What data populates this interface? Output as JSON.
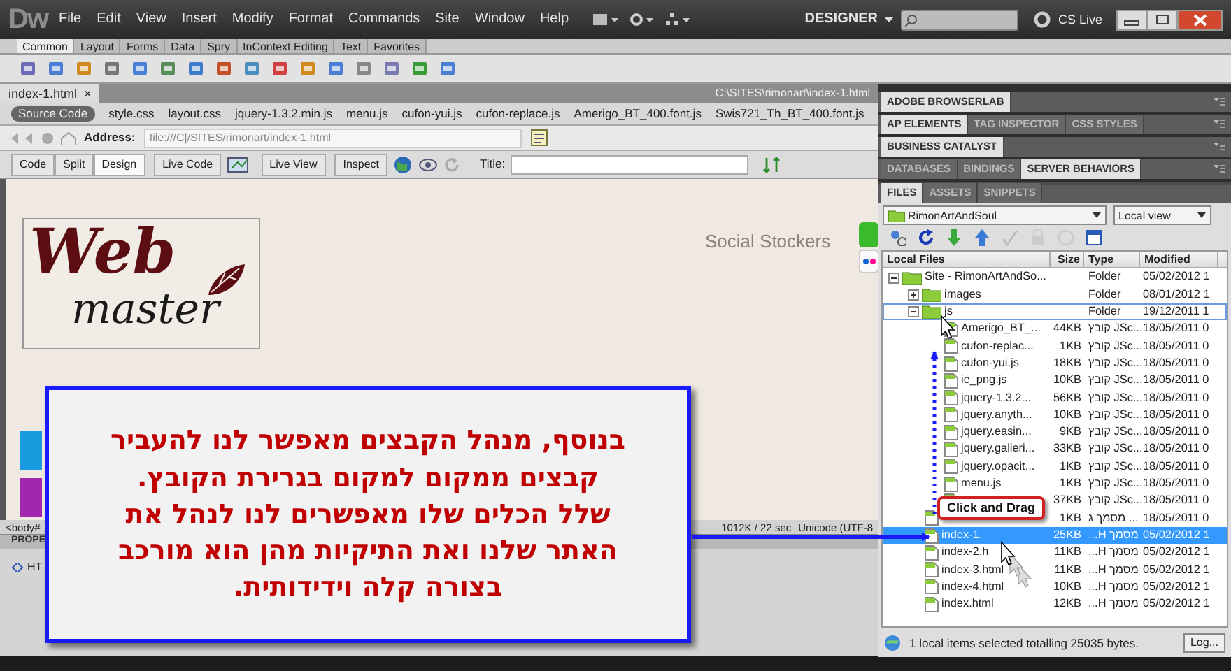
{
  "app": {
    "logo": "Dw",
    "menus": [
      "File",
      "Edit",
      "View",
      "Insert",
      "Modify",
      "Format",
      "Commands",
      "Site",
      "Window",
      "Help"
    ],
    "workspace": "DESIGNER",
    "cs_live": "CS Live"
  },
  "insert_bar": {
    "tabs": [
      {
        "label": "Common",
        "selected": true
      },
      {
        "label": "Layout",
        "selected": false
      },
      {
        "label": "Forms",
        "selected": false
      },
      {
        "label": "Data",
        "selected": false
      },
      {
        "label": "Spry",
        "selected": false
      },
      {
        "label": "InContext Editing",
        "selected": false
      },
      {
        "label": "Text",
        "selected": false
      },
      {
        "label": "Favorites",
        "selected": false
      }
    ]
  },
  "document": {
    "tab": "index-1.html",
    "close": "×",
    "path": "C:\\SITES\\rimonart\\index-1.html",
    "related_files": [
      {
        "label": "Source Code",
        "selected": true
      },
      {
        "label": "style.css",
        "selected": false
      },
      {
        "label": "layout.css",
        "selected": false
      },
      {
        "label": "jquery-1.3.2.min.js",
        "selected": false
      },
      {
        "label": "menu.js",
        "selected": false
      },
      {
        "label": "cufon-yui.js",
        "selected": false
      },
      {
        "label": "cufon-replace.js",
        "selected": false
      },
      {
        "label": "Amerigo_BT_400.font.js",
        "selected": false
      },
      {
        "label": "Swis721_Th_BT_400.font.js",
        "selected": false
      }
    ],
    "address_label": "Address:",
    "address": "file:///C|/SITES/rimonart/index-1.html",
    "view_buttons": [
      {
        "label": "Code",
        "selected": false
      },
      {
        "label": "Split",
        "selected": false
      },
      {
        "label": "Design",
        "selected": true
      }
    ],
    "tool_buttons": [
      "Live Code",
      "Live View",
      "Inspect"
    ],
    "title_label": "Title:"
  },
  "design_view": {
    "logo_top": "Web",
    "logo_bottom": "master",
    "social_label": "Social Stockers"
  },
  "status_bar": {
    "tag": "<body#",
    "size": "1012K / 22 sec",
    "encoding": "Unicode (UTF-8"
  },
  "properties": {
    "header": "PROPE",
    "html_button": "HT"
  },
  "panels": [
    {
      "tabs": [
        {
          "label": "ADOBE BROWSERLAB",
          "selected": true
        }
      ]
    },
    {
      "tabs": [
        {
          "label": "AP ELEMENTS",
          "selected": true
        },
        {
          "label": "TAG INSPECTOR",
          "selected": false
        },
        {
          "label": "CSS STYLES",
          "selected": false
        }
      ]
    },
    {
      "tabs": [
        {
          "label": "BUSINESS CATALYST",
          "selected": true
        }
      ]
    },
    {
      "tabs": [
        {
          "label": "DATABASES",
          "selected": false
        },
        {
          "label": "BINDINGS",
          "selected": false
        },
        {
          "label": "SERVER BEHAVIORS",
          "selected": true
        }
      ]
    }
  ],
  "files": {
    "tabs": [
      {
        "label": "FILES",
        "selected": true
      },
      {
        "label": "ASSETS",
        "selected": false
      },
      {
        "label": "SNIPPETS",
        "selected": false
      }
    ],
    "site": "RimonArtAndSoul",
    "view": "Local view",
    "columns": [
      "Local Files",
      "Size",
      "Type",
      "Modified"
    ],
    "tree": [
      {
        "kind": "folder",
        "name": "Site - RimonArtAndSo...",
        "type": "Folder",
        "modified": "05/02/2012 1",
        "expanded": true,
        "selected": false,
        "highlighted": false,
        "children": [
          {
            "kind": "folder",
            "name": "images",
            "type": "Folder",
            "modified": "08/01/2012 1",
            "expanded": false,
            "selected": false,
            "highlighted": false
          },
          {
            "kind": "folder",
            "name": "js",
            "type": "Folder",
            "modified": "19/12/2011 1",
            "expanded": true,
            "selected": false,
            "highlighted": true,
            "children": [
              {
                "kind": "file",
                "name": "Amerigo_BT_...",
                "size": "44KB",
                "type": "קובץ JSc...",
                "modified": "18/05/2011 0",
                "selected": false,
                "highlighted": false
              },
              {
                "kind": "file",
                "name": "cufon-replac...",
                "size": "1KB",
                "type": "קובץ JSc...",
                "modified": "18/05/2011 0",
                "selected": false,
                "highlighted": false
              },
              {
                "kind": "file",
                "name": "cufon-yui.js",
                "size": "18KB",
                "type": "קובץ JSc...",
                "modified": "18/05/2011 0",
                "selected": false,
                "highlighted": false
              },
              {
                "kind": "file",
                "name": "ie_png.js",
                "size": "10KB",
                "type": "קובץ JSc...",
                "modified": "18/05/2011 0",
                "selected": false,
                "highlighted": false
              },
              {
                "kind": "file",
                "name": "jquery-1.3.2...",
                "size": "56KB",
                "type": "קובץ JSc...",
                "modified": "18/05/2011 0",
                "selected": false,
                "highlighted": false
              },
              {
                "kind": "file",
                "name": "jquery.anyth...",
                "size": "10KB",
                "type": "קובץ JSc...",
                "modified": "18/05/2011 0",
                "selected": false,
                "highlighted": false
              },
              {
                "kind": "file",
                "name": "jquery.easin...",
                "size": "9KB",
                "type": "קובץ JSc...",
                "modified": "18/05/2011 0",
                "selected": false,
                "highlighted": false
              },
              {
                "kind": "file",
                "name": "jquery.galleri...",
                "size": "33KB",
                "type": "קובץ JSc...",
                "modified": "18/05/2011 0",
                "selected": false,
                "highlighted": false
              },
              {
                "kind": "file",
                "name": "jquery.opacit...",
                "size": "1KB",
                "type": "קובץ JSc...",
                "modified": "18/05/2011 0",
                "selected": false,
                "highlighted": false
              },
              {
                "kind": "file",
                "name": "menu.js",
                "size": "1KB",
                "type": "קובץ JSc...",
                "modified": "18/05/2011 0",
                "selected": false,
                "highlighted": false
              },
              {
                "kind": "file",
                "size": "37KB",
                "type": "קובץ JSc...",
                "modified": "18/05/2011 0",
                "selected": false,
                "highlighted": false
              }
            ]
          },
          {
            "kind": "file",
            "size": "1KB",
            "type": "מסמך ג ...",
            "modified": "18/05/2011 0",
            "selected": false,
            "highlighted": false
          },
          {
            "kind": "file",
            "name": "index-1.",
            "size": "25KB",
            "type": "...H מסמך",
            "modified": "05/02/2012 1",
            "selected": true,
            "highlighted": false
          },
          {
            "kind": "file",
            "name": "index-2.h",
            "size": "11KB",
            "type": "...H מסמך",
            "modified": "05/02/2012 1",
            "selected": false,
            "highlighted": false
          },
          {
            "kind": "file",
            "name": "index-3.html",
            "size": "11KB",
            "type": "...H מסמך",
            "modified": "05/02/2012 1",
            "selected": false,
            "highlighted": false
          },
          {
            "kind": "file",
            "name": "index-4.html",
            "size": "10KB",
            "type": "...H מסמך",
            "modified": "05/02/2012 1",
            "selected": false,
            "highlighted": false
          },
          {
            "kind": "file",
            "name": "index.html",
            "size": "12KB",
            "type": "...H מסמך",
            "modified": "05/02/2012 1",
            "selected": false,
            "highlighted": false
          }
        ]
      }
    ],
    "status": "1 local items selected totalling 25035 bytes.",
    "log_button": "Log..."
  },
  "callout": {
    "lines": [
      "בנוסף, מנהל הקבצים מאפשר לנו להעביר",
      "קבצים ממקום למקום בגרירת הקובץ.",
      "שלל הכלים שלו מאפשרים לנו לנהל את",
      "האתר שלנו ואת התיקיות מהן הוא מורכב",
      "בצורה קלה וידידותית."
    ]
  },
  "tooltip": "Click and Drag"
}
